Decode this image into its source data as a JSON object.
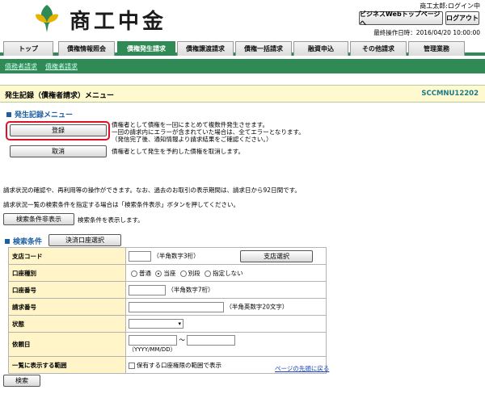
{
  "header": {
    "logo_text": "商工中金",
    "user_name": "商工太郎:ログイン中",
    "btn_bizweb": "ビジネスWebトップページへ",
    "btn_logout": "ログアウト",
    "last_operation": "最終操作日時：2016/04/20 10:00:00"
  },
  "tabs": [
    {
      "label": "トップ"
    },
    {
      "label": "債権情報照会"
    },
    {
      "label": "債権発生請求"
    },
    {
      "label": "債権譲渡請求"
    },
    {
      "label": "債権一括請求"
    },
    {
      "label": "融資申込"
    },
    {
      "label": "その他請求"
    },
    {
      "label": "管理業務"
    }
  ],
  "subnav": [
    "債務者請求",
    "債権者請求"
  ],
  "title_bar": {
    "title": "発生記録（債権者請求）メニュー",
    "screen_id": "SCCMNU12202"
  },
  "menu_section": {
    "heading": "発生記録メニュー",
    "register_label": "登録",
    "register_desc_1": "債権者として債権を一回にまとめて複数件発生させます。",
    "register_desc_2": "一回の請求内にエラーが含まれていた場合は、全てエラーとなります。",
    "register_desc_3": "（発信完了後、通知情報より請求結果をご確認ください。）",
    "cancel_label": "取消",
    "cancel_desc": "債権者として発生を予約した債権を取消します。"
  },
  "info": {
    "line1": "請求状況の確認や、再利用等の操作ができます。なお、過去のお取引の表示期間は、請求日から92日間です。",
    "line2": "請求状況一覧の検索条件を指定する場合は「検索条件表示」ボタンを押してください。",
    "toggle_button": "検索条件非表示",
    "toggle_desc": "検索条件を表示します。"
  },
  "search": {
    "heading": "検索条件",
    "account_button": "決済口座選択",
    "rows": {
      "branch_code": {
        "label": "支店コード",
        "hint": "（半角数字3桁）",
        "button": "支店選択"
      },
      "account_type": {
        "label": "口座種別",
        "options": [
          "普通",
          "当座",
          "別段",
          "指定しない"
        ],
        "selected": "当座"
      },
      "account_number": {
        "label": "口座番号",
        "hint": "（半角数字7桁）"
      },
      "request_number": {
        "label": "請求番号",
        "hint": "（半角英数字20文字）"
      },
      "status": {
        "label": "状態",
        "value": ""
      },
      "date": {
        "label": "依頼日",
        "range_sep": "～",
        "format": "（YYYY/MM/DD）"
      },
      "range": {
        "label": "一覧に表示する範囲",
        "checkbox_label": "保有する口座権限の範囲で表示"
      }
    },
    "page_top_link": "ページの先頭に戻る",
    "search_button": "検索"
  },
  "colors": {
    "accent": "#2f8a55",
    "title_bg": "#fff9d0",
    "label_bg": "#fff5c8",
    "highlight": "#e0102a",
    "heading": "#1e5fa0"
  }
}
